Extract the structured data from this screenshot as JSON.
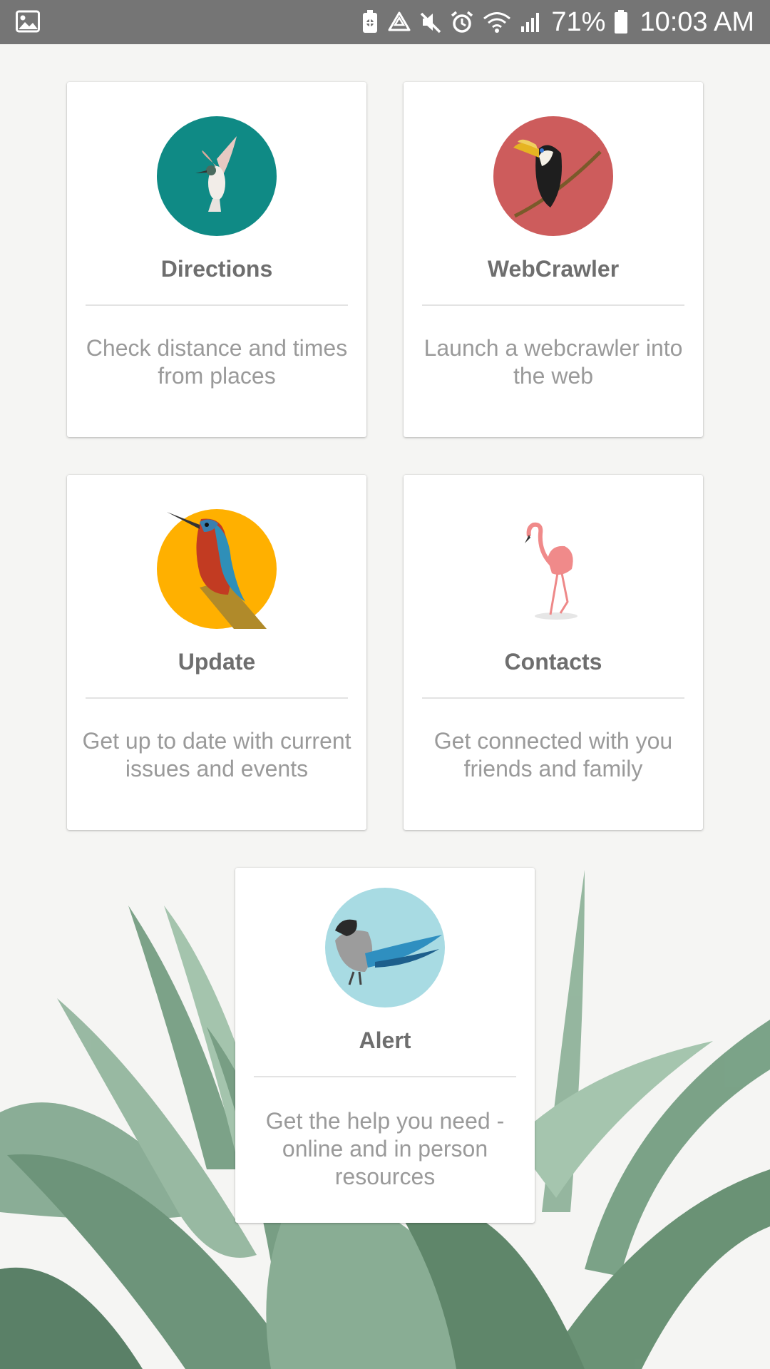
{
  "status_bar": {
    "battery_percent": "71%",
    "time": "10:03 AM",
    "icons": [
      "gallery-icon",
      "battery-saver-icon",
      "recycle-icon",
      "mute-icon",
      "alarm-icon",
      "wifi-icon",
      "signal-icon",
      "battery-icon"
    ]
  },
  "cards": [
    {
      "title": "Directions",
      "description": "Check distance and times from places",
      "icon": "hummingbird",
      "color": "#0f8a85"
    },
    {
      "title": "WebCrawler",
      "description": "Launch a webcrawler into the web",
      "icon": "toucan",
      "color": "#cd5c5c"
    },
    {
      "title": "Update",
      "description": "Get up to date with current issues and events",
      "icon": "kingfisher",
      "color": "#ffb000"
    },
    {
      "title": "Contacts",
      "description": "Get connected with you friends and family",
      "icon": "flamingo",
      "color": "#f08a8a"
    },
    {
      "title": "Alert",
      "description": "Get the help you need - online and in person resources",
      "icon": "magpie",
      "color": "#a8dbe3"
    }
  ]
}
